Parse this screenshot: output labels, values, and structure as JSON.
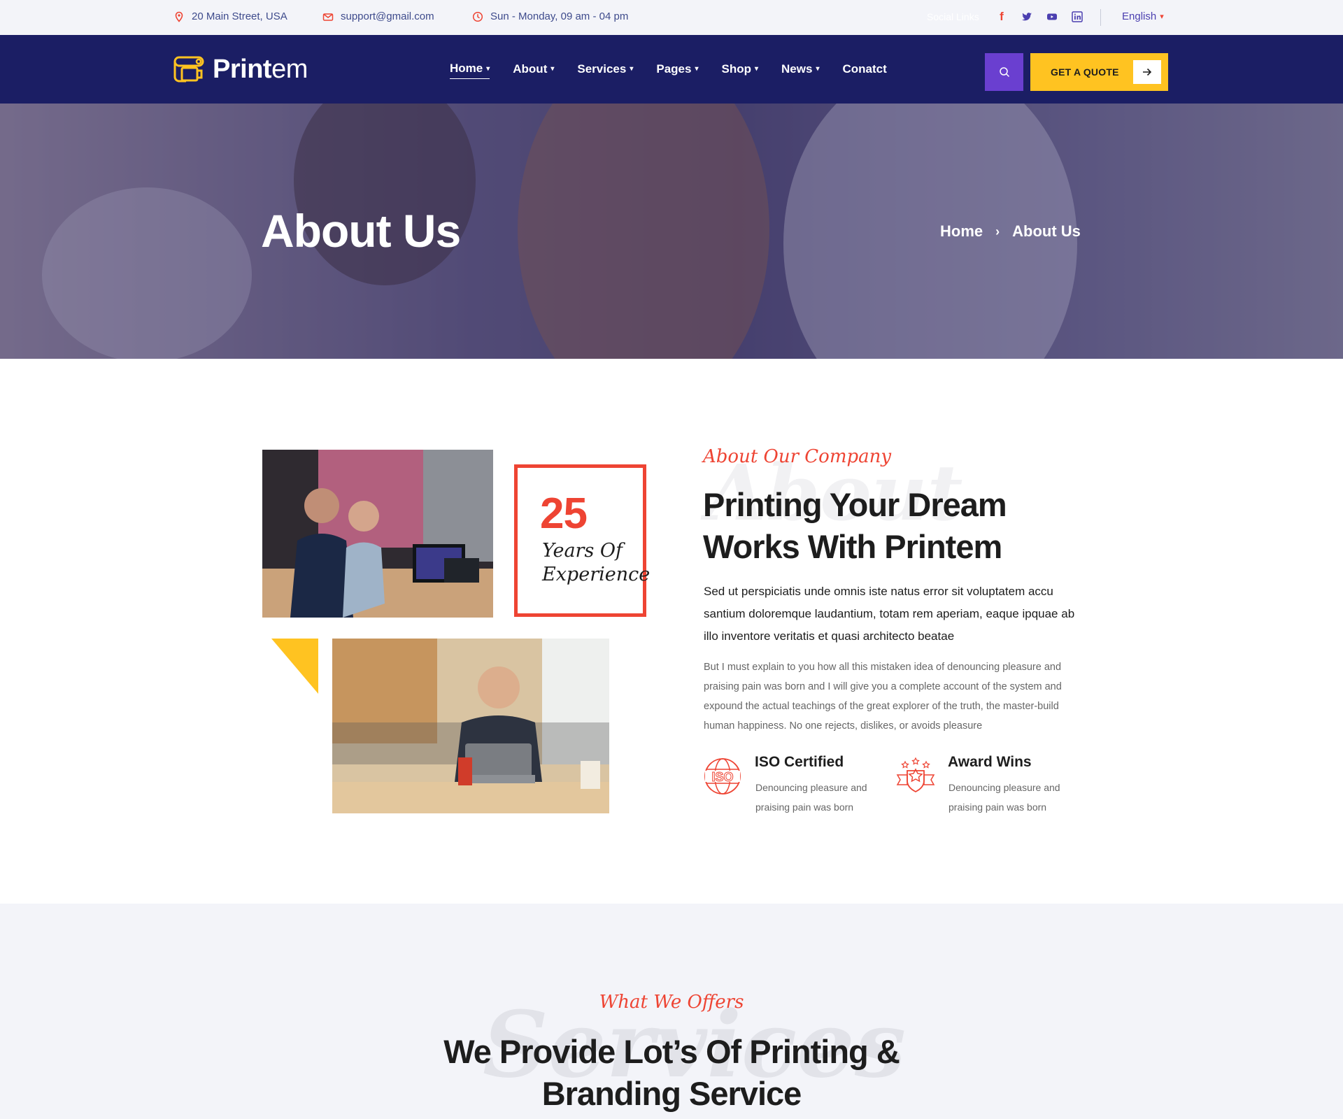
{
  "colors": {
    "primary": "#1b1e64",
    "accent": "#ee4433",
    "yellow": "#ffc321",
    "purple": "#6a3fd0",
    "topbar": "#f3f4f9"
  },
  "topbar": {
    "address": "20 Main Street, USA",
    "email": "support@gmail.com",
    "hours": "Sun - Monday, 09 am - 04 pm",
    "social_label": "Social Links",
    "social": [
      "facebook-icon",
      "twitter-icon",
      "youtube-icon",
      "linkedin-icon"
    ],
    "language": "English"
  },
  "nav": {
    "logo_bold": "Print",
    "logo_light": "em",
    "items": [
      {
        "label": "Home",
        "active": true
      },
      {
        "label": "About"
      },
      {
        "label": "Services"
      },
      {
        "label": "Pages"
      },
      {
        "label": "Shop"
      },
      {
        "label": "News"
      },
      {
        "label": "Conatct"
      }
    ],
    "quote_label": "GET A QUOTE"
  },
  "hero": {
    "title": "About Us",
    "breadcrumb": [
      "Home",
      "About Us"
    ]
  },
  "about": {
    "experience_number": "25",
    "experience_line1": "Years Of",
    "experience_line2": "Experience",
    "tag": "About Our Company",
    "watermark": "About",
    "heading": "Printing Your Dream Works With Printem",
    "lead": "Sed ut perspiciatis unde omnis iste natus error sit voluptatem accu santium doloremque laudantium, totam rem aperiam, eaque ipquae ab illo inventore veritatis et quasi architecto beatae",
    "paragraph": "But I must explain to you how all this mistaken idea of denouncing pleasure and praising pain was born and I will give you a complete account of the system and expound the actual teachings of the great explorer of the truth, the master-build human happiness. No one rejects, dislikes, or avoids pleasure",
    "features": [
      {
        "icon": "iso-icon",
        "title": "ISO Certified",
        "desc": "Denouncing pleasure and praising pain was born"
      },
      {
        "icon": "award-icon",
        "title": "Award Wins",
        "desc": "Denouncing pleasure and praising pain was born"
      }
    ]
  },
  "services": {
    "watermark": "Services",
    "tag": "What We Offers",
    "heading": "We Provide Lot’s Of Printing & Branding Service"
  }
}
